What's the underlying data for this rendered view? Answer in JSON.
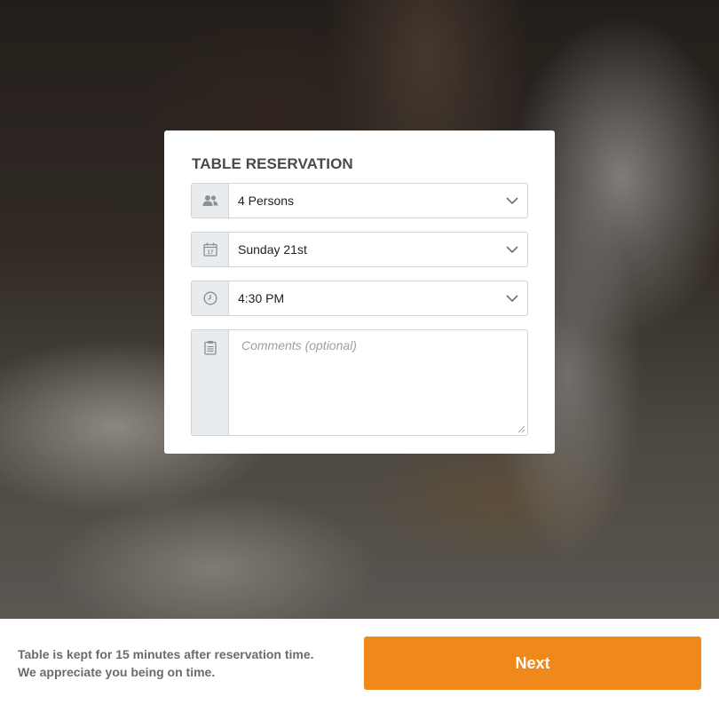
{
  "reservation": {
    "title": "TABLE RESERVATION",
    "party_size": {
      "icon": "people-icon",
      "value": "4 Persons"
    },
    "date": {
      "icon": "calendar-icon",
      "value": "Sunday 21st"
    },
    "time": {
      "icon": "clock-icon",
      "value": "4:30 PM"
    },
    "comments": {
      "icon": "clipboard-icon",
      "placeholder": "Comments (optional)",
      "value": ""
    }
  },
  "footer": {
    "note_line1": "Table is kept for 15 minutes after reservation time.",
    "note_line2": "We appreciate you being on time.",
    "next_label": "Next"
  },
  "colors": {
    "accent": "#f0891b",
    "addon_bg": "#e9ecef",
    "border": "#cfd4d9"
  }
}
